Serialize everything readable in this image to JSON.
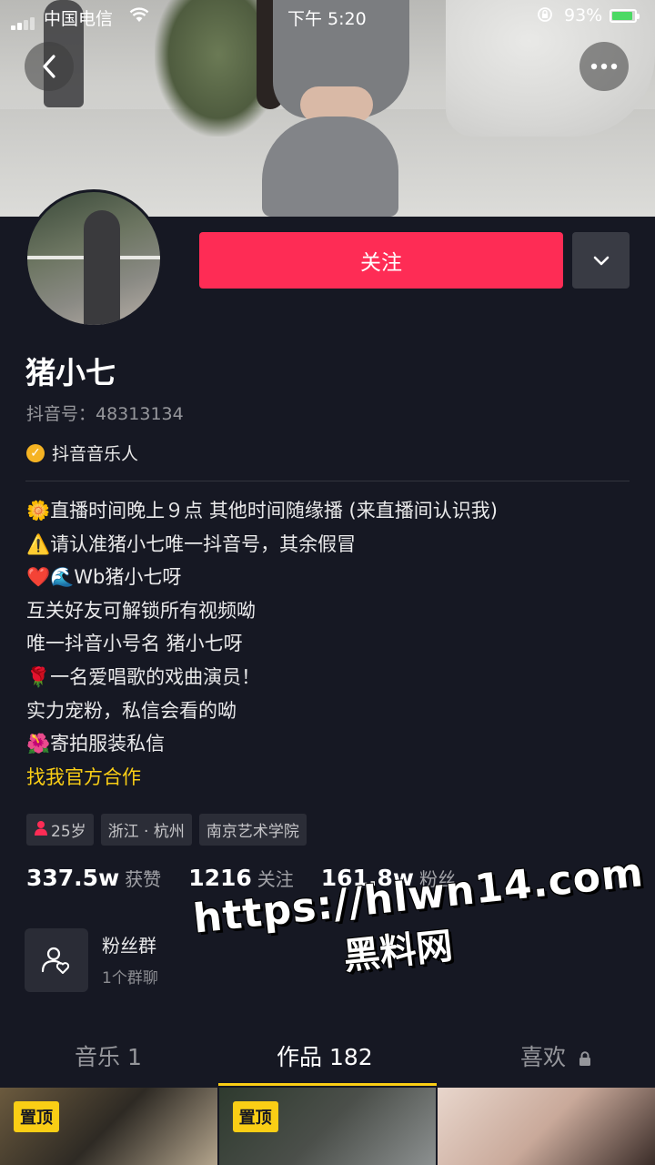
{
  "status_bar": {
    "carrier": "中国电信",
    "time": "下午 5:20",
    "battery_percent": "93%",
    "battery_level": 0.93
  },
  "icons": {
    "back": "chevron-left-icon",
    "more": "more-dots-icon",
    "dropdown": "chevron-down-icon",
    "verified": "check-badge-icon",
    "fan_group": "people-heart-icon",
    "lock": "lock-icon"
  },
  "profile": {
    "follow_label": "关注",
    "name": "猪小七",
    "douyin_id": "抖音号：48313134",
    "badge": "抖音音乐人"
  },
  "bio": [
    "🌼直播时间晚上９点 其他时间随缘播 (来直播间认识我)",
    "⚠️请认准猪小七唯一抖音号，其余假冒",
    "❤️🌊Wb猪小七呀",
    "互关好友可解锁所有视频呦",
    "唯一抖音小号名 猪小七呀",
    "🌹一名爱唱歌的戏曲演员！",
    "实力宠粉，私信会看的呦",
    "🌺寄拍服装私信"
  ],
  "bio_link": "找我官方合作",
  "tags": {
    "age": "25岁",
    "location": "浙江 · 杭州",
    "school": "南京艺术学院"
  },
  "stats": [
    {
      "num": "337.5w",
      "label": "获赞"
    },
    {
      "num": "1216",
      "label": "关注"
    },
    {
      "num": "161.8w",
      "label": "粉丝"
    }
  ],
  "fan_group": {
    "title": "粉丝群",
    "subtitle": "1个群聊"
  },
  "watermark": {
    "url": "https://hlwn14.com",
    "cn": "黑料网"
  },
  "tabs": {
    "music": "音乐 1",
    "works": "作品 182",
    "likes": "喜欢"
  },
  "grid": {
    "pin_label": "置顶"
  },
  "colors": {
    "background": "#161823",
    "follow": "#fe2c55",
    "accent_yellow": "#face15",
    "badge_gold": "#f5b323"
  }
}
